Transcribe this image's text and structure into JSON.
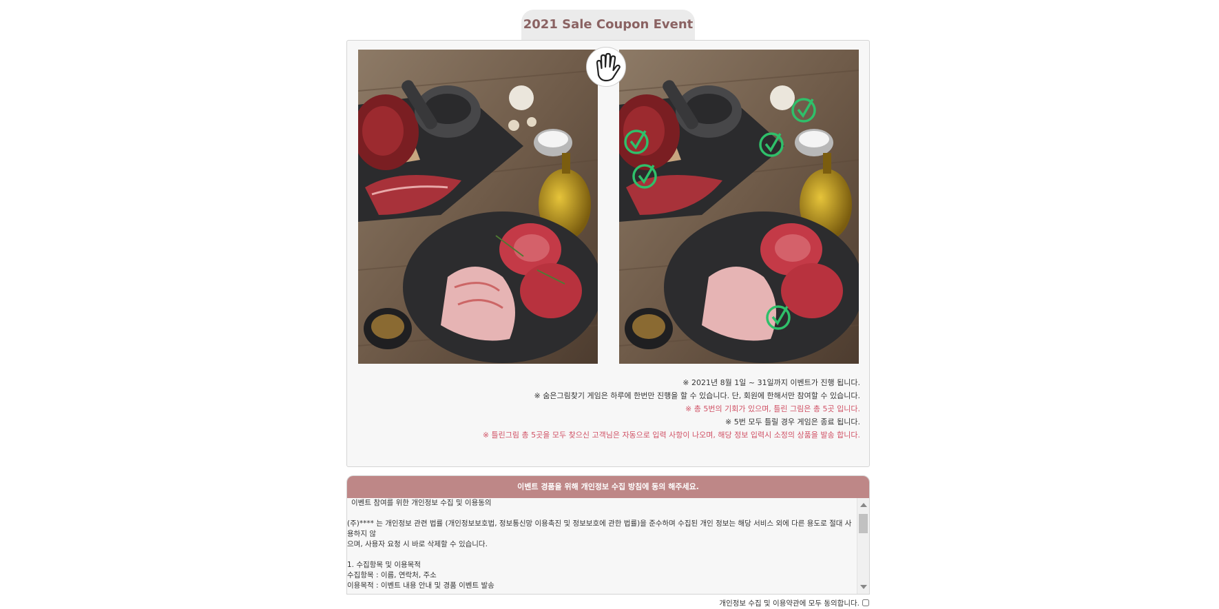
{
  "event": {
    "title": "2021 Sale Coupon Event"
  },
  "game": {
    "left_image": "original-meat-photo",
    "right_image": "meat-photo-with-differences",
    "center_icon": "hand-icon",
    "found_marks": 5,
    "mark_color": "#2fc06a"
  },
  "notes": [
    {
      "text": "※ 2021년 8월 1일 ~ 31일까지 이벤트가 진행 됩니다.",
      "color": "#333333"
    },
    {
      "text": "※ 숨은그림찾기 게임은 하루에 한번만 진행을 할 수 있습니다. 단, 회원에 한해서만 참여할 수 있습니다.",
      "color": "#333333"
    },
    {
      "text": "※ 총 5번의 기회가 있으며, 틀린 그림은 총 5곳 입니다.",
      "color": "#d05064"
    },
    {
      "text": "※ 5번 모두 틀릴 경우 게임은 종료 됩니다.",
      "color": "#333333"
    },
    {
      "text": "※ 틀린그림 총 5곳을 모두 찾으신 고객님은 자동으로 입력 사항이 나오며, 해당 정보 입력시 소정의 상품을 발송 합니다.",
      "color": "#d05064"
    }
  ],
  "consent": {
    "header": "이벤트 경품을 위해 개인정보 수집 방침에 동의 해주세요.",
    "lines": [
      " 이벤트 참여를 위한 개인정보 수집 및 이용동의",
      "",
      "(주)**** 는 개인정보 관련 법률 (개인정보보호법, 정보통신망 이용촉진 및 정보보호에 관한 법률)을 준수하며 수집된 개인 정보는 해당 서비스 외에 다른 용도로 절대 사용하지 않",
      "으며, 사용자 요청 시 바로 삭제할 수 있습니다.",
      "",
      "1. 수집항목 및 이용목적",
      "수집항목 : 이름, 연락처, 주소",
      "이용목적 : 이벤트 내용 안내 및 경품 이벤트 발송"
    ],
    "header_color": "#be8787"
  },
  "agree": {
    "label": "개인정보 수집 및 이용약관에 모두 동의합니다.",
    "checked": false
  }
}
